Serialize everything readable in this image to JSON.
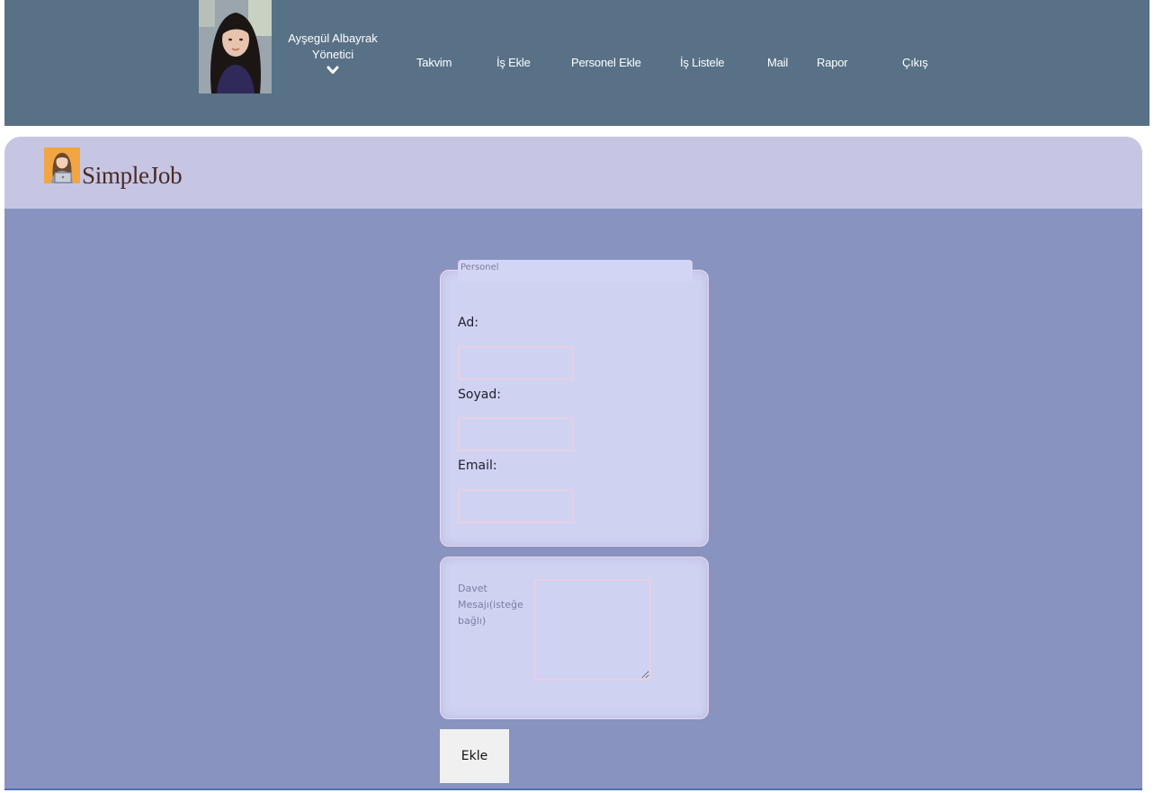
{
  "header": {
    "user": {
      "name": "Ayşegül Albayrak",
      "role": "Yönetici",
      "avatar_icon": "user-photo",
      "menu_icon": "chevron-down-icon"
    },
    "nav": [
      {
        "label": "Takvim"
      },
      {
        "label": "İş Ekle"
      },
      {
        "label": "Personel Ekle"
      },
      {
        "label": "İş Listele"
      },
      {
        "label": "Mail"
      },
      {
        "label": "Rapor"
      },
      {
        "label": "Çıkış"
      }
    ]
  },
  "brand": {
    "name": "SimpleJob",
    "logo_icon": "office-worker-icon"
  },
  "form": {
    "legend": "Personel",
    "fields": [
      {
        "label": "Ad:",
        "value": ""
      },
      {
        "label": "Soyad:",
        "value": ""
      },
      {
        "label": "Email:",
        "value": ""
      }
    ],
    "invite": {
      "label": "Davet Mesajı(isteğe bağlı)",
      "value": ""
    },
    "submit_label": "Ekle"
  },
  "colors": {
    "topbar": "#587186",
    "brand_band": "#c6c6e4",
    "content_bg": "#8893bf",
    "panel_bg": "#d0d2f2"
  }
}
